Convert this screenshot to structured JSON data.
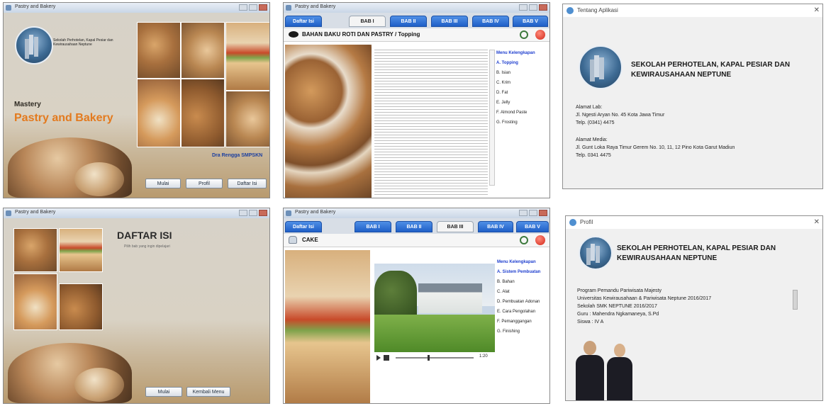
{
  "s1": {
    "window_title": "Pastry and Bakery",
    "logo_text": "Sekolah Perhotelan, Kapal Pesiar dan Kewirausahaan Neptune",
    "subtitle": "Mastery",
    "title": "Pastry and Bakery",
    "credit": "Dra Rengga SMPSKN",
    "buttons": [
      "Mulai",
      "Profil",
      "Daftar Isi"
    ]
  },
  "s2": {
    "window_title": "Pastry and Bakery",
    "tabs": [
      "Daftar Isi",
      "BAB I",
      "BAB II",
      "BAB III",
      "BAB IV",
      "BAB V"
    ],
    "active_tab": 1,
    "section_title": "BAHAN BAKU ROTI DAN PASTRY / Topping",
    "menu_head": "Menu Kelengkapan",
    "menu_items": [
      "A. Topping",
      "B. Isian",
      "C. Krim",
      "D. Fat",
      "E. Jelly",
      "F. Almond Paste",
      "G. Frosting"
    ]
  },
  "s3": {
    "window_title": "Tentang Aplikasi",
    "heading_line1": "SEKOLAH PERHOTELAN, KAPAL PESIAR DAN",
    "heading_line2": "KEWIRAUSAHAAN NEPTUNE",
    "addr1_label": "Alamat Lab:",
    "addr1_line1": "Jl. Ngesti Aryan No. 45 Kota Jawa Timur",
    "addr1_line2": "Telp. (0341) 4475",
    "addr2_label": "Alamat Media:",
    "addr2_line1": "Jl. Gunt Loka Raya Timur Gerem No. 10, 11, 12 Pino Kota Garut Madiun",
    "addr2_line2": "Telp. 0341 4475"
  },
  "s4": {
    "window_title": "Pastry and Bakery",
    "title": "DAFTAR ISI",
    "subtitle": "Pilih bab yang ingin dipelajari",
    "buttons": [
      "Mulai",
      "Kembali Menu"
    ]
  },
  "s5": {
    "window_title": "Pastry and Bakery",
    "tabs": [
      "Daftar Isi",
      "BAB I",
      "BAB II",
      "BAB III",
      "BAB IV",
      "BAB V"
    ],
    "active_tab": 3,
    "section_title": "CAKE",
    "menu_head": "Menu Kelengkapan",
    "menu_items": [
      "A. Sistem Pembuatan",
      "B. Bahan",
      "C. Alat",
      "D. Pembuatan Adonan",
      "E. Cara Pengolahan",
      "F. Pemanggangan",
      "G. Finishing"
    ],
    "video_time": "1:20"
  },
  "s6": {
    "window_title": "Profil",
    "heading_line1": "SEKOLAH PERHOTELAN, KAPAL PESIAR DAN",
    "heading_line2": "KEWIRAUSAHAAN NEPTUNE",
    "info": [
      "Program Pemandu Pariwisata Majesty",
      "Universitas Kewirausahaan & Pariwisata Neptune 2016/2017",
      "Sekolah SMK NEPTUNE 2016/2017",
      "Guru  : Mahendra Ngkamaneya, S.Pd",
      "Siswa : IV A"
    ]
  }
}
